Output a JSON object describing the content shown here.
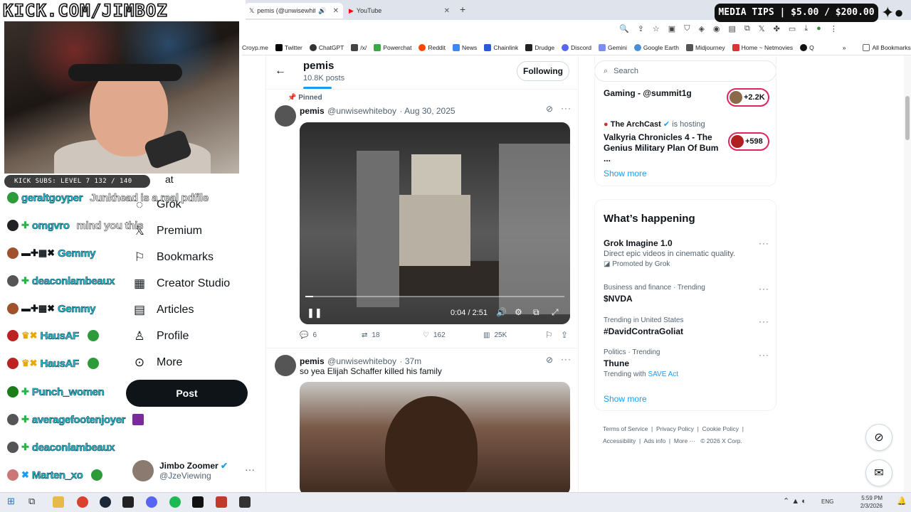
{
  "browser": {
    "tabs": [
      {
        "title": "pemis (@unwisewhiteboy)",
        "active": true
      },
      {
        "title": "YouTube",
        "active": false
      }
    ],
    "new_tab": "+",
    "bookmarks": [
      "Croyp.me",
      "Twitter",
      "ChatGPT",
      "/x/",
      "Powerchat",
      "Reddit",
      "News",
      "Chainlink",
      "Drudge",
      "Discord",
      "Gemini",
      "Google Earth",
      "Midjourney",
      "Home ~ Netmovies",
      "Q"
    ],
    "all_bookmarks": "All Bookmarks"
  },
  "overlay": {
    "kick_url": "KICK.COM/JIMBOZ",
    "kick_subs": "KICK SUBS: LEVEL 7 132 / 140",
    "media_tips": "MEDIA TIPS | $5.00 / $200.00",
    "chat": [
      {
        "name": "geraltgoyper",
        "message": "Junkhead is a real pdfile"
      },
      {
        "name": "omgvro",
        "message": "mind you this"
      },
      {
        "name": "Gemmy",
        "message": ""
      },
      {
        "name": "deaconlambeaux",
        "message": ""
      },
      {
        "name": "Gemmy",
        "message": ""
      },
      {
        "name": "HausAF",
        "message": ""
      },
      {
        "name": "HausAF",
        "message": ""
      },
      {
        "name": "Punch_women",
        "message": ""
      },
      {
        "name": "averagefootenjoyer",
        "message": ""
      },
      {
        "name": "deaconlambeaux",
        "message": ""
      },
      {
        "name": "Marten_xo",
        "message": ""
      }
    ]
  },
  "nav": {
    "items": [
      {
        "label": "Grok",
        "icon": "grok-icon"
      },
      {
        "label": "Premium",
        "icon": "x-icon"
      },
      {
        "label": "Bookmarks",
        "icon": "bookmark-icon"
      },
      {
        "label": "Creator Studio",
        "icon": "creator-studio-icon"
      },
      {
        "label": "Articles",
        "icon": "articles-icon"
      },
      {
        "label": "Profile",
        "icon": "person-icon"
      },
      {
        "label": "More",
        "icon": "more-icon"
      }
    ],
    "post_label": "Post",
    "account": {
      "name": "Jimbo Zoomer",
      "handle": "@JzeViewing"
    }
  },
  "profile": {
    "name": "pemis",
    "posts_count": "10.8K posts",
    "follow_label": "Following"
  },
  "tweets": [
    {
      "pinned_label": "Pinned",
      "name": "pemis",
      "handle": "@unwisewhiteboy",
      "time": "· Aug 30, 2025",
      "video_time": "0:04 / 2:51",
      "video_progress": 0.03,
      "stats": {
        "replies": "6",
        "reposts": "18",
        "likes": "162",
        "views": "25K"
      }
    },
    {
      "name": "pemis",
      "handle": "@unwisewhiteboy",
      "time": "· 37m",
      "text": "so yea Elijah Schaffer killed his family"
    }
  ],
  "right": {
    "search_placeholder": "Search",
    "live": [
      {
        "title": "Gaming - @summit1g",
        "count": "+2.2K"
      },
      {
        "host": "The ArchCast",
        "hosting": "is hosting",
        "title": "Valkyria Chronicles 4 - The Genius Military Plan Of Bum ...",
        "count": "+598"
      }
    ],
    "show_more": "Show more",
    "whats_happening": "What’s happening",
    "trends": [
      {
        "category": "",
        "title": "Grok Imagine 1.0",
        "subtitle": "Direct epic videos in cinematic quality.",
        "promoted": "Promoted by Grok"
      },
      {
        "category": "Business and finance · Trending",
        "title": "$NVDA"
      },
      {
        "category": "Trending in United States",
        "title": "#DavidContraGoliat"
      },
      {
        "category": "Politics · Trending",
        "title": "Thune",
        "trending_with": "Trending with",
        "with_link": "SAVE Act"
      }
    ],
    "show_more_2": "Show more",
    "footer": [
      "Terms of Service",
      "Privacy Policy",
      "Cookie Policy",
      "Accessibility",
      "Ads info",
      "More ···",
      "© 2026 X Corp."
    ]
  },
  "taskbar": {
    "lang": "ENG",
    "time": "5:59 PM",
    "date": "2/3/2026"
  },
  "colors": {
    "accent": "#1d9bf0",
    "chat_name": "#26c6da",
    "dark": "#0f1419"
  }
}
